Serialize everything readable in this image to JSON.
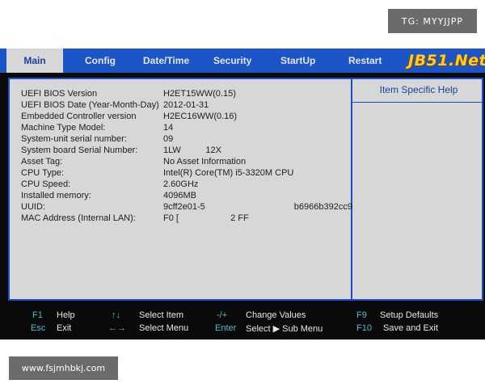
{
  "watermarks": {
    "top_right": "TG: MYYJJPP",
    "bottom_left": "www.fsjmhbkj.com"
  },
  "logo": "JB51.Net",
  "tabs": [
    "Main",
    "Config",
    "Date/Time",
    "Security",
    "StartUp",
    "Restart"
  ],
  "help": {
    "title": "Item Specific Help"
  },
  "info": [
    {
      "label": "UEFI BIOS Version",
      "value": "H2ET15WW(0.15)"
    },
    {
      "label": "UEFI BIOS Date (Year-Month-Day)",
      "value": "2012-01-31"
    },
    {
      "label": "Embedded Controller version",
      "value": "H2EC16WW(0.16)"
    },
    {
      "label": "Machine Type Model:",
      "value": "14"
    },
    {
      "label": "System-unit serial number:",
      "value": "09"
    },
    {
      "label": "System board Serial Number:",
      "value": "1LW          12X"
    },
    {
      "label": "Asset Tag:",
      "value": "No Asset Information"
    },
    {
      "label": "CPU Type:",
      "value": "Intel(R) Core(TM) i5-3320M CPU"
    },
    {
      "label": "CPU Speed:",
      "value": "2.60GHz"
    },
    {
      "label": "Installed memory:",
      "value": "4096MB"
    },
    {
      "label": "UUID:",
      "value": "9cff2e01-5                                    b6966b392cc9"
    },
    {
      "label": "MAC Address (Internal LAN):",
      "value": "F0 [                     2 FF"
    }
  ],
  "footer": [
    {
      "key": "F1",
      "desc": "Help"
    },
    {
      "key": "Esc",
      "desc": "Exit"
    },
    {
      "key": "↑↓",
      "desc": "Select Item"
    },
    {
      "key": "←→",
      "desc": "Select Menu"
    },
    {
      "key": "-/+",
      "desc": "Change Values"
    },
    {
      "key": "Enter",
      "desc": "Select ▶ Sub Menu"
    },
    {
      "key": "F9",
      "desc": "Setup Defaults"
    },
    {
      "key": "F10",
      "desc": "Save and Exit"
    }
  ],
  "colors": {
    "tabbar": "#1b55c7",
    "panel": "#d7d7d7",
    "border": "#1b4fc9",
    "footer_key": "#4fbfc8",
    "logo": "#ffcc2e"
  }
}
